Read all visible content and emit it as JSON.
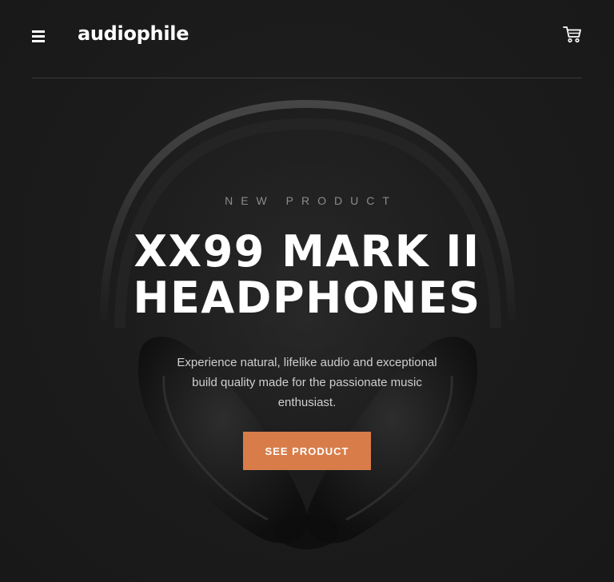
{
  "header": {
    "logo": "audiophile",
    "menu_icon": "hamburger-menu-icon",
    "cart_icon": "shopping-cart-icon"
  },
  "hero": {
    "overline": "New Product",
    "title_line1": "XX99 Mark II",
    "title_line2": "Headphones",
    "description": "Experience natural, lifelike audio and exceptional build quality made for the passionate music enthusiast.",
    "cta_label": "See Product",
    "image": "headphones-illustration"
  },
  "colors": {
    "background": "#191919",
    "accent": "#d87d4a",
    "divider": "#3b3b3b",
    "text_primary": "#ffffff",
    "text_muted": "#8c8c8c"
  }
}
